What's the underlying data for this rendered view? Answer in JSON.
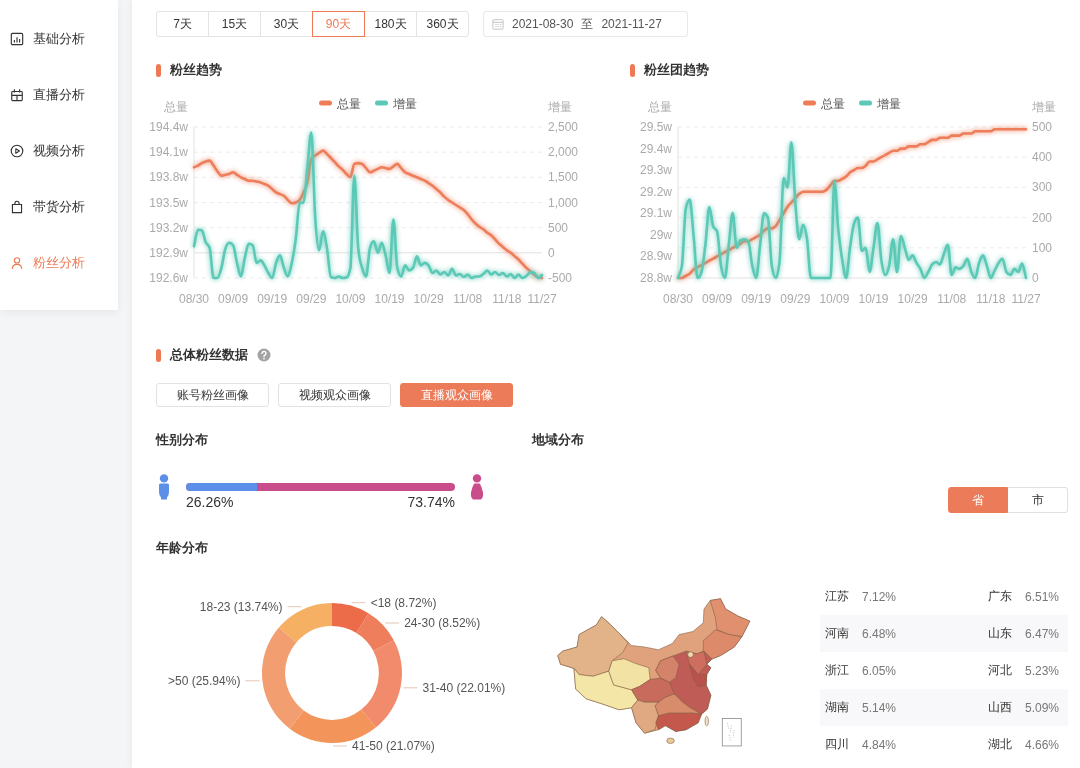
{
  "sidebar": {
    "items": [
      {
        "label": "基础分析",
        "selected": false
      },
      {
        "label": "直播分析",
        "selected": false
      },
      {
        "label": "视频分析",
        "selected": false
      },
      {
        "label": "带货分析",
        "selected": false
      },
      {
        "label": "粉丝分析",
        "selected": true
      }
    ]
  },
  "period_tabs": [
    {
      "label": "7天",
      "selected": false
    },
    {
      "label": "15天",
      "selected": false
    },
    {
      "label": "30天",
      "selected": false
    },
    {
      "label": "90天",
      "selected": true
    },
    {
      "label": "180天",
      "selected": false
    },
    {
      "label": "360天",
      "selected": false
    }
  ],
  "date_range": {
    "start": "2021-08-30",
    "separator": "至",
    "end": "2021-11-27"
  },
  "fans_trend": {
    "title": "粉丝趋势",
    "chart_data": {
      "type": "line",
      "ylabel": "总量",
      "y2label": "增量",
      "legend": "top",
      "grid": true,
      "categories": [
        "08/30",
        null,
        null,
        null,
        null,
        null,
        null,
        null,
        null,
        null,
        "09/09",
        null,
        null,
        null,
        null,
        null,
        null,
        null,
        null,
        null,
        "09/19",
        null,
        null,
        null,
        null,
        null,
        null,
        null,
        null,
        null,
        "09/29",
        null,
        null,
        null,
        null,
        null,
        null,
        null,
        null,
        null,
        "10/09",
        null,
        null,
        null,
        null,
        null,
        null,
        null,
        null,
        null,
        "10/19",
        null,
        null,
        null,
        null,
        null,
        null,
        null,
        null,
        null,
        "10/29",
        null,
        null,
        null,
        null,
        null,
        null,
        null,
        null,
        null,
        "11/08",
        null,
        null,
        null,
        null,
        null,
        null,
        null,
        null,
        null,
        "11/18",
        null,
        null,
        null,
        null,
        null,
        null,
        null,
        null,
        "11/27"
      ],
      "ylim": [
        192.6,
        194.4
      ],
      "yticks": [
        {
          "value": 192.6,
          "label": "192.6w"
        },
        {
          "value": 192.9,
          "label": "192.9w"
        },
        {
          "value": 193.2,
          "label": "193.2w"
        },
        {
          "value": 193.5,
          "label": "193.5w"
        },
        {
          "value": 193.8,
          "label": "193.8w"
        },
        {
          "value": 194.1,
          "label": "194.1w"
        },
        {
          "value": 194.4,
          "label": "194.4w"
        }
      ],
      "y2lim": [
        -500,
        2500
      ],
      "y2ticks": [
        {
          "value": -500,
          "label": "-500"
        },
        0,
        500,
        {
          "value": 1000,
          "label": "1,000"
        },
        {
          "value": 1500,
          "label": "1,500"
        },
        {
          "value": 2000,
          "label": "2,000"
        },
        {
          "value": 2500,
          "label": "2,500"
        }
      ],
      "series": [
        {
          "name": "总量",
          "color": "#ee7d5a",
          "values": [
            193.92,
            193.94,
            193.97,
            193.99,
            194.0,
            193.94,
            193.87,
            193.82,
            193.83,
            193.84,
            193.86,
            193.83,
            193.8,
            193.78,
            193.76,
            193.76,
            193.75,
            193.74,
            193.72,
            193.7,
            193.66,
            193.62,
            193.6,
            193.58,
            193.53,
            193.49,
            193.5,
            193.53,
            193.62,
            193.74,
            194.02,
            194.06,
            194.09,
            194.12,
            194.08,
            194.03,
            193.98,
            193.93,
            193.89,
            193.84,
            193.8,
            193.96,
            193.97,
            193.96,
            193.91,
            193.86,
            193.88,
            193.9,
            193.92,
            193.91,
            193.9,
            193.93,
            193.96,
            193.91,
            193.86,
            193.84,
            193.82,
            193.8,
            193.78,
            193.76,
            193.73,
            193.7,
            193.66,
            193.62,
            193.57,
            193.53,
            193.5,
            193.47,
            193.44,
            193.41,
            193.36,
            193.3,
            193.25,
            193.21,
            193.18,
            193.14,
            193.11,
            193.06,
            193.01,
            192.97,
            192.93,
            192.9,
            192.86,
            192.82,
            192.77,
            192.72,
            192.68,
            192.64,
            192.61,
            192.6
          ]
        },
        {
          "name": "增量",
          "color": "#5cc9b6",
          "axis": "y2",
          "values": [
            130,
            460,
            450,
            210,
            100,
            -500,
            -500,
            -300,
            80,
            200,
            150,
            -200,
            -470,
            -100,
            180,
            150,
            -200,
            -150,
            -250,
            -400,
            -500,
            -200,
            -50,
            -300,
            -470,
            -200,
            260,
            990,
            1000,
            1700,
            2390,
            700,
            50,
            430,
            100,
            -480,
            -500,
            -470,
            -500,
            -490,
            -300,
            1530,
            100,
            -300,
            -470,
            100,
            230,
            0,
            200,
            -50,
            -400,
            660,
            -300,
            -470,
            -250,
            -350,
            -300,
            -70,
            -250,
            -200,
            -250,
            -400,
            -350,
            -430,
            -380,
            -450,
            -320,
            -450,
            -420,
            -480,
            -430,
            -500,
            -470,
            -470,
            -420,
            -350,
            -430,
            -380,
            -440,
            -400,
            -470,
            -420,
            -500,
            -430,
            -500,
            -460,
            -380,
            -400,
            -500,
            -440
          ]
        }
      ]
    }
  },
  "fan_club_trend": {
    "title": "粉丝团趋势",
    "chart_data": {
      "type": "line",
      "ylabel": "总量",
      "y2label": "增量",
      "legend": "top",
      "grid": true,
      "categories": [
        "08/30",
        null,
        null,
        null,
        null,
        null,
        null,
        null,
        null,
        null,
        "09/09",
        null,
        null,
        null,
        null,
        null,
        null,
        null,
        null,
        null,
        "09/19",
        null,
        null,
        null,
        null,
        null,
        null,
        null,
        null,
        null,
        "09/29",
        null,
        null,
        null,
        null,
        null,
        null,
        null,
        null,
        null,
        "10/09",
        null,
        null,
        null,
        null,
        null,
        null,
        null,
        null,
        null,
        "10/19",
        null,
        null,
        null,
        null,
        null,
        null,
        null,
        null,
        null,
        "10/29",
        null,
        null,
        null,
        null,
        null,
        null,
        null,
        null,
        null,
        "11/08",
        null,
        null,
        null,
        null,
        null,
        null,
        null,
        null,
        null,
        "11/18",
        null,
        null,
        null,
        null,
        null,
        null,
        null,
        null,
        "11/27"
      ],
      "ylim": [
        28.8,
        29.5
      ],
      "yticks": [
        {
          "value": 28.8,
          "label": "28.8w"
        },
        {
          "value": 28.9,
          "label": "28.9w"
        },
        {
          "value": 29,
          "label": "29w"
        },
        {
          "value": 29.1,
          "label": "29.1w"
        },
        {
          "value": 29.2,
          "label": "29.2w"
        },
        {
          "value": 29.3,
          "label": "29.3w"
        },
        {
          "value": 29.4,
          "label": "29.4w"
        },
        {
          "value": 29.5,
          "label": "29.5w"
        }
      ],
      "y2lim": [
        0,
        500
      ],
      "y2ticks": [
        0,
        100,
        200,
        300,
        400,
        500
      ],
      "series": [
        {
          "name": "总量",
          "color": "#ee7d5a",
          "values": [
            28.8,
            28.8,
            28.81,
            28.82,
            28.84,
            28.85,
            28.86,
            28.87,
            28.88,
            28.89,
            28.9,
            28.91,
            28.92,
            28.93,
            28.94,
            28.95,
            28.96,
            28.97,
            28.97,
            28.98,
            28.99,
            29.0,
            29.02,
            29.03,
            29.03,
            29.04,
            29.07,
            29.1,
            29.13,
            29.15,
            29.17,
            29.19,
            29.2,
            29.2,
            29.2,
            29.2,
            29.2,
            29.2,
            29.21,
            29.23,
            29.25,
            29.25,
            29.26,
            29.27,
            29.29,
            29.3,
            29.31,
            29.31,
            29.32,
            29.34,
            29.34,
            29.35,
            29.36,
            29.37,
            29.38,
            29.39,
            29.39,
            29.4,
            29.4,
            29.41,
            29.41,
            29.41,
            29.42,
            29.42,
            29.43,
            29.44,
            29.44,
            29.45,
            29.45,
            29.45,
            29.46,
            29.46,
            29.46,
            29.47,
            29.47,
            29.47,
            29.48,
            29.48,
            29.48,
            29.48,
            29.48,
            29.49,
            29.49,
            29.49,
            29.49,
            29.49,
            29.49,
            29.49,
            29.49,
            29.49
          ]
        },
        {
          "name": "增量",
          "color": "#5cc9b6",
          "axis": "y2",
          "values": [
            0,
            40,
            230,
            260,
            140,
            0,
            20,
            110,
            235,
            171,
            155,
            40,
            0,
            110,
            215,
            100,
            125,
            128,
            120,
            40,
            0,
            110,
            214,
            200,
            40,
            0,
            60,
            331,
            300,
            449,
            250,
            128,
            176,
            130,
            0,
            0,
            0,
            0,
            0,
            0,
            321,
            160,
            60,
            0,
            100,
            180,
            200,
            90,
            100,
            20,
            100,
            182,
            60,
            10,
            40,
            128,
            20,
            139,
            100,
            60,
            75,
            50,
            30,
            0,
            20,
            45,
            53,
            45,
            80,
            110,
            10,
            35,
            30,
            40,
            64,
            20,
            0,
            50,
            75,
            40,
            0,
            25,
            50,
            64,
            20,
            10,
            30,
            20,
            48,
            0
          ]
        }
      ]
    }
  },
  "overall": {
    "title": "总体粉丝数据",
    "portrait_tabs": [
      {
        "label": "账号粉丝画像",
        "selected": false
      },
      {
        "label": "视频观众画像",
        "selected": false
      },
      {
        "label": "直播观众画像",
        "selected": true
      }
    ],
    "gender": {
      "title": "性别分布",
      "level": 0.2626,
      "male_share": "26.26%",
      "female_share": "73.74%"
    },
    "age": {
      "title": "年龄分布",
      "chart_data": {
        "type": "donut",
        "values": [
          8.72,
          8.52,
          22.01,
          21.07,
          25.94,
          13.74
        ],
        "colors": [
          "#ec6b48",
          "#ef7e5d",
          "#f28b6c",
          "#f3955a",
          "#f29e70",
          "#f5b064"
        ],
        "value_labels": [
          "<18 (8.72%)",
          "24-30 (8.52%)",
          "31-40 (22.01%)",
          "41-50 (21.07%)",
          ">50 (25.94%)",
          "18-23 (13.74%)"
        ]
      }
    },
    "region": {
      "title": "地域分布",
      "scope_tabs": [
        {
          "label": "省",
          "selected": true
        },
        {
          "label": "市",
          "selected": false
        }
      ],
      "provinces": [
        {
          "name": "江苏",
          "share": "7.12%"
        },
        {
          "name": "广东",
          "share": "6.51%"
        },
        {
          "name": "河南",
          "share": "6.48%"
        },
        {
          "name": "山东",
          "share": "6.47%"
        },
        {
          "name": "浙江",
          "share": "6.05%"
        },
        {
          "name": "河北",
          "share": "5.23%"
        },
        {
          "name": "湖南",
          "share": "5.14%"
        },
        {
          "name": "山西",
          "share": "5.09%"
        },
        {
          "name": "四川",
          "share": "4.84%"
        },
        {
          "name": "湖北",
          "share": "4.66%"
        }
      ]
    }
  }
}
